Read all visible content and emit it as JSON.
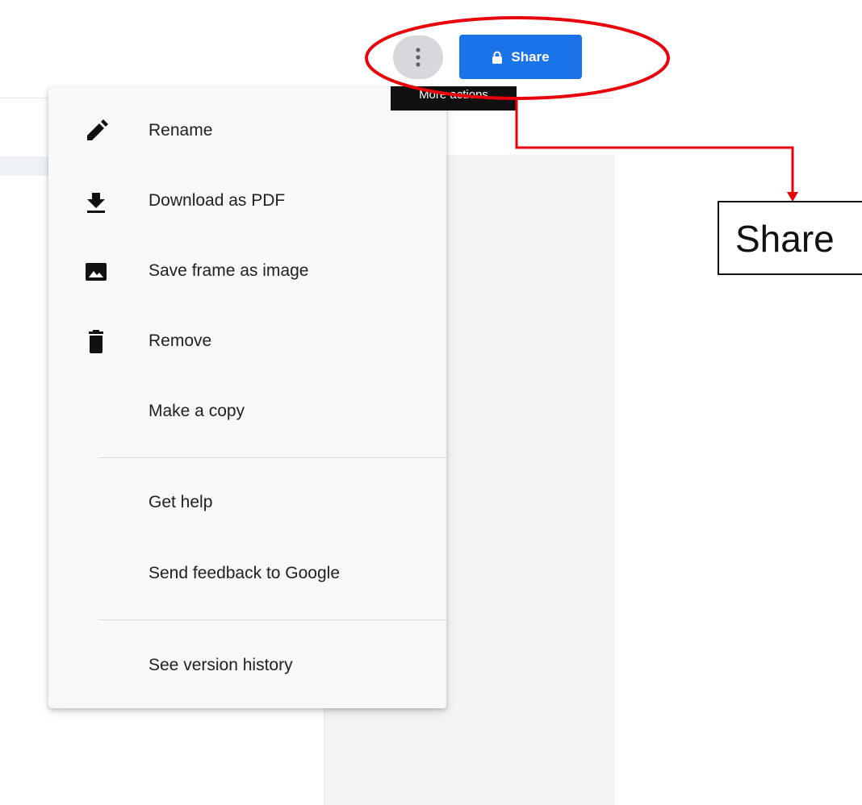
{
  "toolbar": {
    "more_button_icon": "more-vert-icon",
    "share_button": {
      "label": "Share",
      "icon": "lock-icon",
      "color": "#1a73e8"
    },
    "tooltip": "More actions"
  },
  "menu": {
    "items": [
      {
        "label": "Rename",
        "icon": "pencil-icon"
      },
      {
        "label": "Download as PDF",
        "icon": "download-icon"
      },
      {
        "label": "Save frame as image",
        "icon": "image-icon"
      },
      {
        "label": "Remove",
        "icon": "trash-icon"
      },
      {
        "label": "Make a copy",
        "icon": ""
      },
      {
        "label": "Get help",
        "icon": ""
      },
      {
        "label": "Send feedback to Google",
        "icon": ""
      },
      {
        "label": "See version history",
        "icon": ""
      }
    ]
  },
  "annotation": {
    "callout_label": "Share",
    "highlight_color": "#e8000b"
  }
}
